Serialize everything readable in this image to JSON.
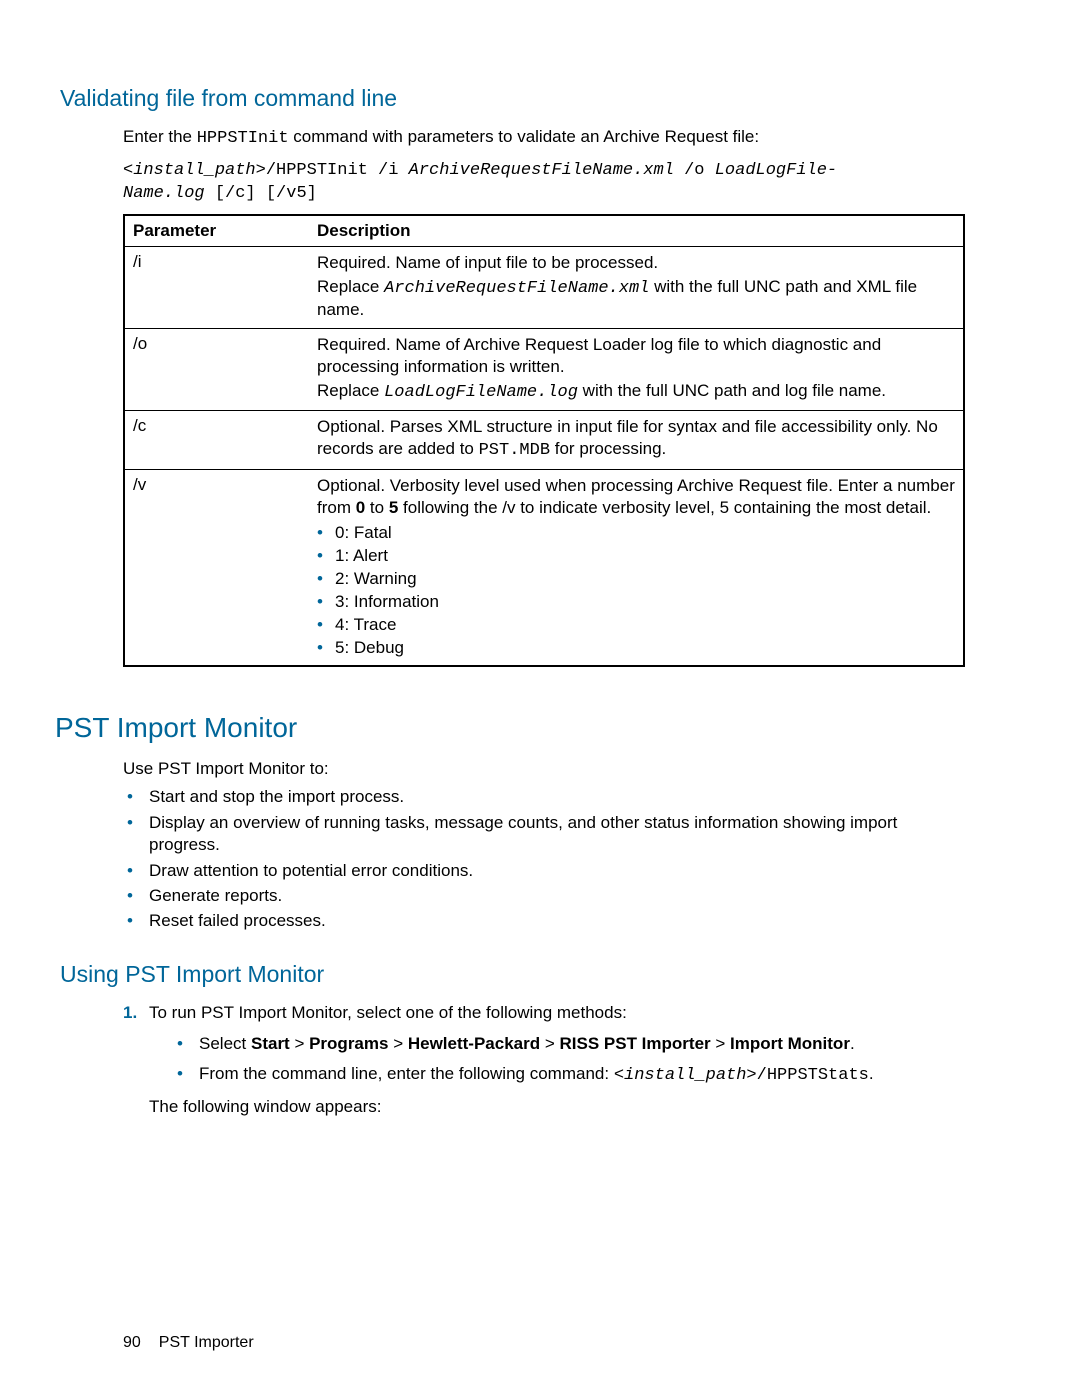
{
  "sec1": {
    "heading": "Validating file from command line",
    "intro_pre": "Enter the ",
    "intro_code": "HPPSTInit",
    "intro_post": " command with parameters to validate an Archive Request file:",
    "cmd_l1_a": "<install_path>",
    "cmd_l1_b": "/HPPSTInit /i ",
    "cmd_l1_c": "ArchiveRequestFileName.xml",
    "cmd_l1_d": " /o ",
    "cmd_l1_e": "LoadLogFile-",
    "cmd_l2_a": "Name.log",
    "cmd_l2_b": " [/c] [/v5]",
    "th1": "Parameter",
    "th2": "Description",
    "rows": {
      "r0": {
        "param": "/i",
        "p1": "Required. Name of input file to be processed.",
        "p2a": "Replace ",
        "p2b": "ArchiveRequestFileName.xml",
        "p2c": " with the full UNC path and XML file name."
      },
      "r1": {
        "param": "/o",
        "p1": "Required. Name of Archive Request Loader log file to which diagnostic and processing information is written.",
        "p2a": "Replace ",
        "p2b": "LoadLogFileName.log",
        "p2c": " with the full UNC path and log file name."
      },
      "r2": {
        "param": "/c",
        "p1a": "Optional. Parses XML structure in input file for syntax and file accessibility only. No records are added to ",
        "p1b": "PST.MDB",
        "p1c": " for processing."
      },
      "r3": {
        "param": "/v",
        "p1a": "Optional. Verbosity level used when processing Archive Request file. Enter a number from ",
        "p1b": "0",
        "p1c": " to ",
        "p1d": "5",
        "p1e": " following the /v to indicate verbosity level, 5 containing the most detail.",
        "li0": "0: Fatal",
        "li1": "1: Alert",
        "li2": "2: Warning",
        "li3": "3: Information",
        "li4": "4: Trace",
        "li5": "5: Debug"
      }
    }
  },
  "sec2": {
    "heading": "PST Import Monitor",
    "intro": "Use PST Import Monitor to:",
    "items": {
      "i0": "Start and stop the import process.",
      "i1": "Display an overview of running tasks, message counts, and other status information showing import progress.",
      "i2": "Draw attention to potential error conditions.",
      "i3": "Generate reports.",
      "i4": "Reset failed processes."
    }
  },
  "sec3": {
    "heading": "Using PST Import Monitor",
    "step1_num": "1.",
    "step1_text": "To run PST Import Monitor, select one of the following methods:",
    "sub1_a": "Select ",
    "sub1_b": "Start",
    "sub1_c": " > ",
    "sub1_d": "Programs",
    "sub1_e": " > ",
    "sub1_f": "Hewlett-Packard",
    "sub1_g": " > ",
    "sub1_h": "RISS PST Importer",
    "sub1_i": " > ",
    "sub1_j": "Import Monitor",
    "sub1_k": ".",
    "sub2_a": "From the command line, enter the following command: ",
    "sub2_b": "<install_path>",
    "sub2_c": "/HPPSTStats",
    "sub2_d": ".",
    "after": "The following window appears:"
  },
  "footer": {
    "page": "90",
    "title": "PST Importer"
  }
}
